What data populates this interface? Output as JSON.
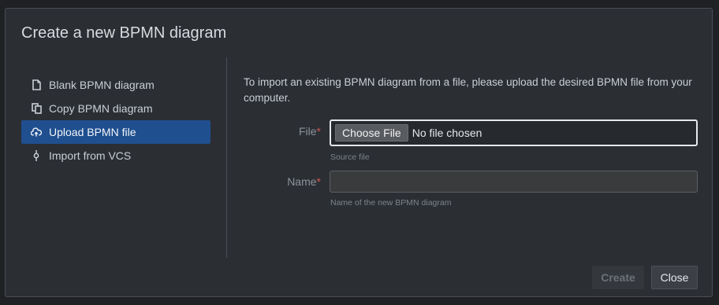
{
  "dialog": {
    "title": "Create a new BPMN diagram"
  },
  "nav": {
    "items": [
      {
        "label": "Blank BPMN diagram",
        "icon": "file-icon",
        "active": false
      },
      {
        "label": "Copy BPMN diagram",
        "icon": "copy-icon",
        "active": false
      },
      {
        "label": "Upload BPMN file",
        "icon": "cloud-upload-icon",
        "active": true
      },
      {
        "label": "Import from VCS",
        "icon": "commit-icon",
        "active": false
      }
    ]
  },
  "form": {
    "intro": "To import an existing BPMN diagram from a file, please upload the desired BPMN file from your computer.",
    "file": {
      "label": "File",
      "required_marker": "*",
      "button_label": "Choose File",
      "status": "No file chosen",
      "help": "Source file"
    },
    "name": {
      "label": "Name",
      "required_marker": "*",
      "value": "",
      "help": "Name of the new BPMN diagram"
    }
  },
  "buttons": {
    "create": "Create",
    "close": "Close"
  },
  "colors": {
    "active_nav": "#1f4f8f",
    "required": "#d05656",
    "background": "#2b2e33"
  }
}
